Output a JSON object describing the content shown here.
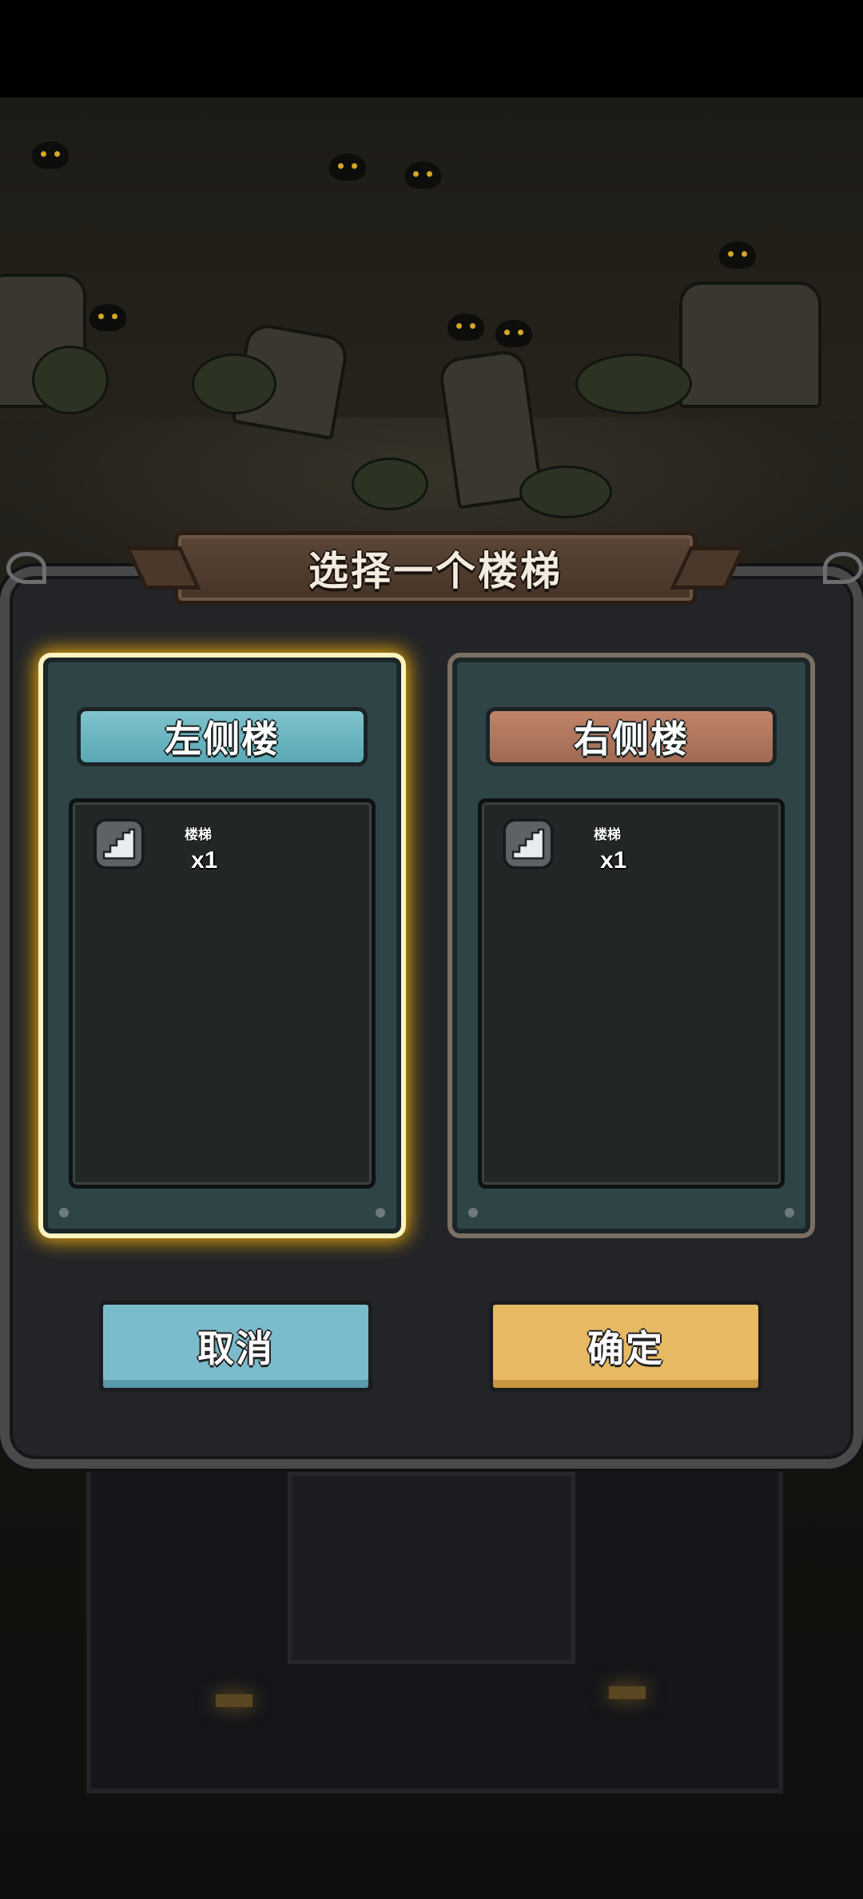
{
  "dialog": {
    "title": "选择一个楼梯",
    "options": [
      {
        "title": "左侧楼",
        "accent": "#6db5c2",
        "selected": true,
        "items": [
          {
            "icon": "stairs-icon",
            "label": "楼梯",
            "quantity": "x1"
          }
        ]
      },
      {
        "title": "右侧楼",
        "accent": "#b57a60",
        "selected": false,
        "items": [
          {
            "icon": "stairs-icon",
            "label": "楼梯",
            "quantity": "x1"
          }
        ]
      }
    ],
    "cancel_label": "取消",
    "confirm_label": "确定"
  },
  "colors": {
    "selected_glow": "#e3a40e",
    "cancel_button": "#7bbccc",
    "confirm_button": "#e7b964"
  }
}
